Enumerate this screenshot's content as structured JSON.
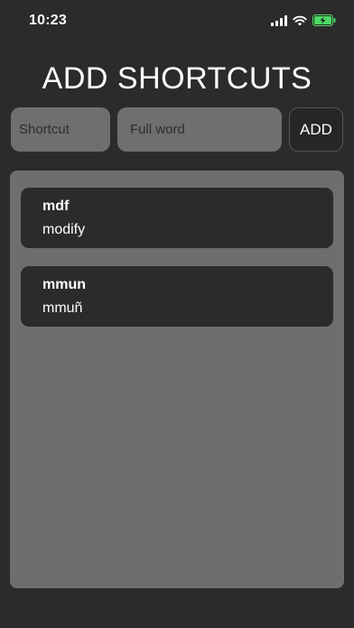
{
  "status_bar": {
    "time": "10:23",
    "icons": [
      "signal-icon",
      "wifi-icon",
      "battery-charging-icon"
    ]
  },
  "page": {
    "title": "ADD SHORTCUTS"
  },
  "form": {
    "shortcut_placeholder": "Shortcut",
    "full_word_placeholder": "Full word",
    "add_label": "ADD"
  },
  "shortcuts": [
    {
      "shortcut": "mdf",
      "full": "modify"
    },
    {
      "shortcut": "mmun",
      "full": "mmuñ"
    }
  ],
  "colors": {
    "background": "#2b2b2b",
    "panel": "#6e6e6e",
    "field": "#6f6f6f",
    "battery": "#4cd964"
  }
}
